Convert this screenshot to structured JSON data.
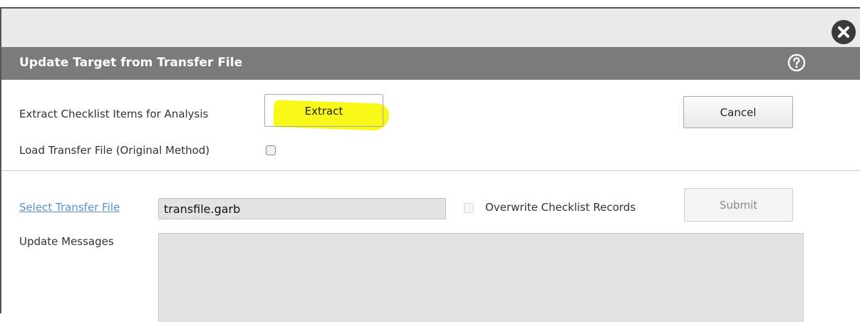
{
  "dialog": {
    "title": "Update Target from Transfer File"
  },
  "extract_row": {
    "label": "Extract Checklist Items for Analysis",
    "extract_button": "Extract",
    "cancel_button": "Cancel"
  },
  "load_row": {
    "label": "Load Transfer File (Original Method)",
    "checked": false
  },
  "transfer": {
    "select_link": "Select Transfer File",
    "file_value": "transfile.garb",
    "overwrite_label": "Overwrite Checklist Records",
    "overwrite_checked": false,
    "submit_button": "Submit",
    "submit_enabled": false
  },
  "messages": {
    "label": "Update Messages",
    "content": ""
  },
  "icons": {
    "close": "close-icon",
    "help": "help-icon"
  },
  "colors": {
    "title_bar": "#7b7b7b",
    "top_bar": "#eaeaea",
    "highlight": "#f7f700",
    "link": "#5b8fd0",
    "field_bg": "#e3e3e3"
  }
}
